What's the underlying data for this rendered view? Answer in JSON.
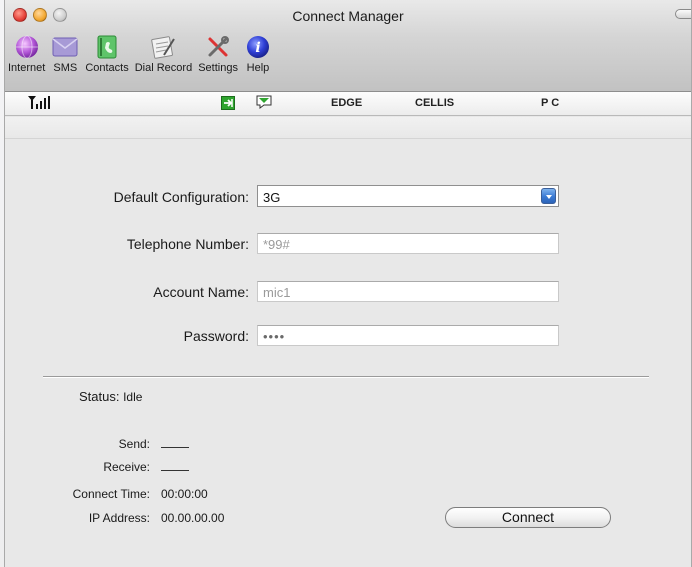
{
  "window": {
    "title": "Connect Manager"
  },
  "toolbar": {
    "items": [
      {
        "label": "Internet",
        "icon": "internet-globe-icon"
      },
      {
        "label": "SMS",
        "icon": "sms-envelope-icon"
      },
      {
        "label": "Contacts",
        "icon": "contacts-book-icon"
      },
      {
        "label": "Dial Record",
        "icon": "dial-record-notepad-icon"
      },
      {
        "label": "Settings",
        "icon": "settings-tools-icon"
      },
      {
        "label": "Help",
        "icon": "help-info-icon"
      }
    ]
  },
  "statusbar": {
    "signal_icon": "signal-strength-icon",
    "network_type": "EDGE",
    "operator": "CELLIS",
    "mode": "P C",
    "accent_green": "#2fa52f"
  },
  "form": {
    "default_configuration_label": "Default Configuration:",
    "default_configuration_value": "3G",
    "telephone_number_label": "Telephone Number:",
    "telephone_number_value": "*99#",
    "account_name_label": "Account Name:",
    "account_name_value": "mic1",
    "password_label": "Password:",
    "password_value": "••••"
  },
  "status": {
    "status_label": "Status:",
    "status_value": "Idle",
    "send_label": "Send:",
    "receive_label": "Receive:",
    "connect_time_label": "Connect Time:",
    "connect_time_value": "00:00:00",
    "ip_address_label": "IP Address:",
    "ip_address_value": "00.00.00.00"
  },
  "actions": {
    "connect_label": "Connect"
  }
}
